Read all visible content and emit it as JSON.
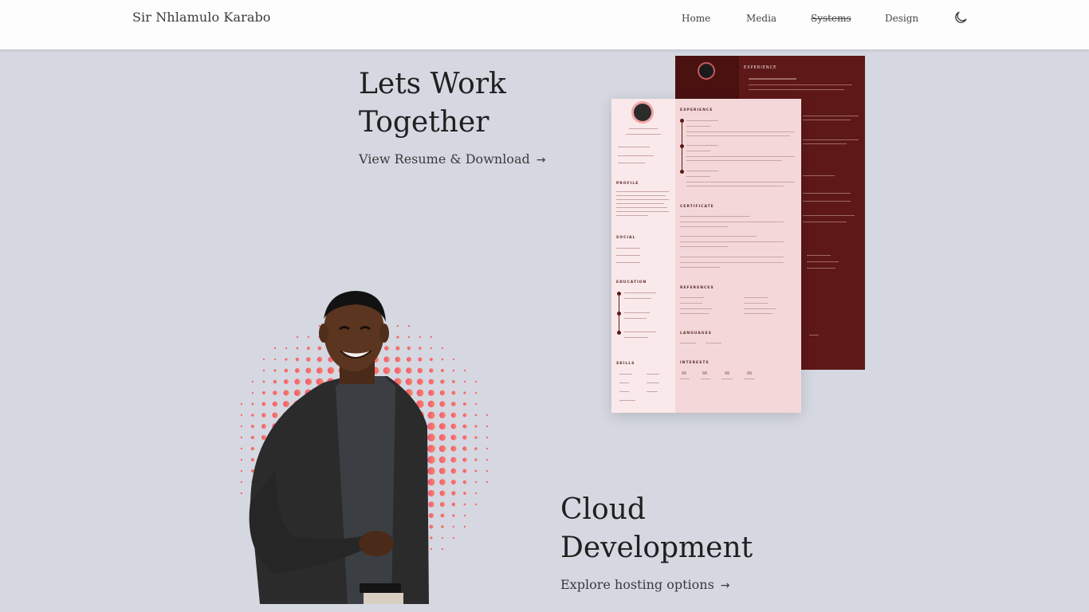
{
  "nav": {
    "brand": "Sir Nhlamulo Karabo",
    "links": [
      "Home",
      "Media",
      "Systems",
      "Design"
    ],
    "theme_icon": "moon-icon"
  },
  "sections": [
    {
      "title_line1": "Lets Work",
      "title_line2": "Together",
      "link_label": "View Resume & Download",
      "link_icon": "arrow-right-icon"
    },
    {
      "title_line1": "Cloud",
      "title_line2": "Development",
      "link_label": "Explore hosting options",
      "link_icon": "arrow-right-icon"
    }
  ],
  "resume_preview": {
    "headings": [
      "EXPERIENCE",
      "PROFILE",
      "SOCIAL",
      "EDUCATION",
      "SKILLS",
      "CERTIFICATE",
      "REFERENCES",
      "LANGUAGES",
      "INTERESTS"
    ]
  },
  "colors": {
    "background": "#d5d8e1",
    "navbar": "#fdfdfd",
    "resume_dark": "#5e1818",
    "resume_light": "#f4d8d9",
    "halftone": "#f06f7e"
  }
}
